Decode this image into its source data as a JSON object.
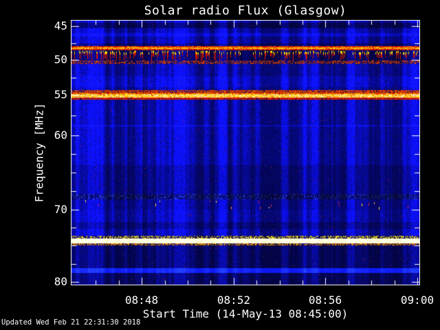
{
  "window": {
    "background": "#000000",
    "text_color": "#ffffff"
  },
  "footer": {
    "updated_text": "Updated Wed Feb 21 22:31:30 2018"
  },
  "chart_data": {
    "type": "heatmap",
    "title": "Solar radio Flux (Glasgow)",
    "xlabel": "Start Time (14-May-13 08:45:00)",
    "ylabel": "Frequency [MHz]",
    "x_start": "08:45:00",
    "x_end": "09:00:00",
    "x_minutes_total": 15,
    "x_major_ticks": [
      {
        "minute": 3,
        "label": "08:48"
      },
      {
        "minute": 7,
        "label": "08:52"
      },
      {
        "minute": 11,
        "label": "08:56"
      },
      {
        "minute": 15,
        "label": "09:00"
      }
    ],
    "x_minor_tick_every_minutes": 1,
    "y_unit": "MHz",
    "y_inverted": true,
    "y_labeled_ticks": [
      45,
      50,
      55,
      60,
      70,
      80
    ],
    "y_minor_ticks": [
      47.5,
      52.5,
      57.5,
      62.5,
      65,
      67.5,
      72.5,
      75,
      77.5
    ],
    "y_axis_map": [
      [
        44.3,
        0
      ],
      [
        45,
        8
      ],
      [
        50,
        57
      ],
      [
        55,
        108
      ],
      [
        60,
        167
      ],
      [
        65,
        221
      ],
      [
        70,
        275
      ],
      [
        75,
        327
      ],
      [
        80,
        380
      ],
      [
        80.4,
        384
      ]
    ],
    "colormap": "callisto blue-red-yellow",
    "background_level_color": "#0d0dcf",
    "bands": [
      {
        "f0": 44.55,
        "f1": 45.3,
        "style": "dark",
        "level": 0.55,
        "label": "dark band near 45 MHz"
      },
      {
        "f0": 46.0,
        "f1": 46.5,
        "style": "bright",
        "level": 1.45,
        "label": "enhanced blue band ~46 MHz"
      },
      {
        "f0": 47.5,
        "f1": 48.0,
        "style": "dark",
        "level": 0.7,
        "label": "dip above RFI carrier"
      },
      {
        "f0": 48.0,
        "f1": 48.6,
        "style": "rfi_line",
        "label": "continuous red/orange RFI carrier ~48.3 MHz"
      },
      {
        "f0": 48.6,
        "f1": 50.1,
        "style": "bursts",
        "label": "intermittent bursty RFI 48.6-50.1 MHz"
      },
      {
        "f0": 50.1,
        "f1": 50.6,
        "style": "red_speckle",
        "density": 0.45,
        "label": "speckled red RFI edge ~50.3 MHz"
      },
      {
        "f0": 52.4,
        "f1": 53.9,
        "style": "bright",
        "level": 1.25,
        "label": "enhanced blue band ~53 MHz"
      },
      {
        "f0": 54.3,
        "f1": 54.7,
        "style": "red_speckle",
        "density": 0.75,
        "label": "red upper edge of 55 MHz RFI"
      },
      {
        "f0": 54.7,
        "f1": 55.35,
        "style": "yellow_core",
        "label": "strong saturated yellow RFI carrier at 55 MHz"
      },
      {
        "f0": 55.35,
        "f1": 55.6,
        "style": "red_solid",
        "label": "red lower edge of 55 MHz RFI"
      },
      {
        "f0": 58.7,
        "f1": 58.9,
        "style": "bright",
        "level": 1.55,
        "label": "thin enhanced line ~58.8 MHz"
      },
      {
        "f0": 64.0,
        "f1": 67.9,
        "style": "dark",
        "level": 0.8,
        "label": "slightly darker region 64-68 MHz"
      },
      {
        "f0": 67.9,
        "f1": 68.6,
        "style": "dark_speckle",
        "label": "dark speckled band ~68 MHz"
      },
      {
        "f0": 68.6,
        "f1": 70.0,
        "style": "sparks",
        "label": "sporadic red/yellow spikes 69-70 MHz"
      },
      {
        "f0": 71.7,
        "f1": 72.7,
        "style": "dark",
        "level": 0.75,
        "label": "darker band ~72 MHz"
      },
      {
        "f0": 73.7,
        "f1": 74.0,
        "style": "yellow_speckle",
        "label": "yellow speckle above 74 MHz carrier"
      },
      {
        "f0": 74.0,
        "f1": 74.7,
        "style": "white_line",
        "label": "saturated white-yellow carrier ~74.4 MHz"
      },
      {
        "f0": 74.7,
        "f1": 75.0,
        "style": "orange_speckle",
        "label": "orange speckle below 74 MHz carrier"
      },
      {
        "f0": 75.0,
        "f1": 78.1,
        "style": "dark",
        "level": 0.62,
        "label": "dark region 75-78 MHz"
      },
      {
        "f0": 78.1,
        "f1": 78.8,
        "style": "bright_solid",
        "label": "bright blue band ~78.5 MHz"
      },
      {
        "f0": 78.8,
        "f1": 80.4,
        "style": "dark",
        "level": 0.62,
        "label": "dark region below 78.8 MHz"
      }
    ]
  }
}
